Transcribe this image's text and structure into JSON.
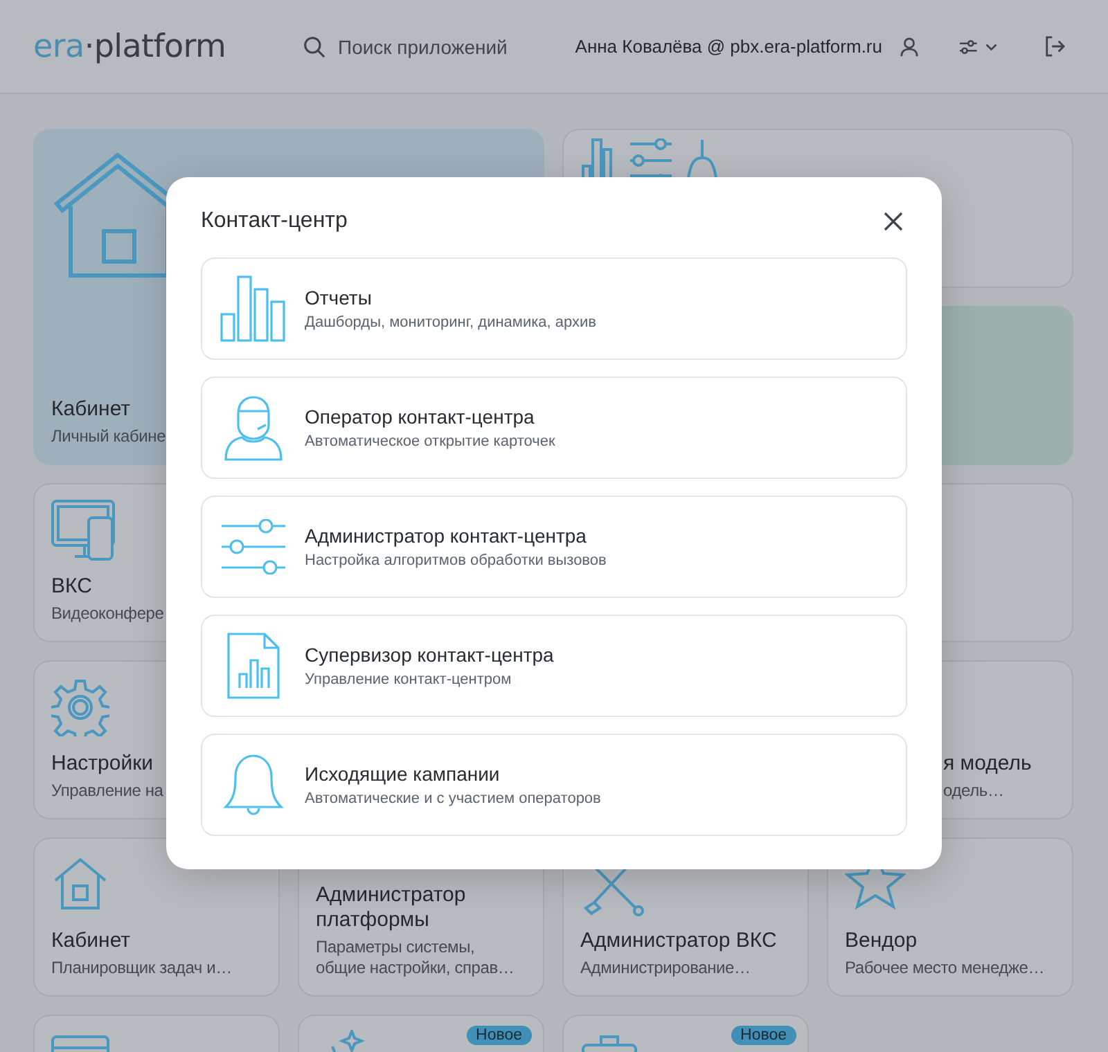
{
  "header": {
    "logo": {
      "accent": "era",
      "rest": "·platform"
    },
    "search": {
      "placeholder": "Поиск приложений"
    },
    "user": "Анна Ковалёва @ pbx.era-platform.ru"
  },
  "tiles": [
    {
      "kind": "featured",
      "title": "Кабинет",
      "subtitle": "Личный кабине"
    },
    {
      "kind": "contact"
    },
    {
      "kind": "accent"
    },
    {
      "kind": "devices",
      "title": "ВКС",
      "subtitle": "Видеоконфере"
    },
    {
      "kind": "blank"
    },
    {
      "kind": "gear",
      "title": "Настройки",
      "subtitle": "Управление на"
    },
    {
      "kind": "partial",
      "title": "я модель",
      "subtitle": "одель…"
    },
    {
      "kind": "home",
      "title": "Кабинет",
      "subtitle": "Планировщик задач и…"
    },
    {
      "kind": "text",
      "title": "Администратор платформы",
      "subtitle": "Параметры системы, общие настройки, справ…"
    },
    {
      "kind": "tools",
      "title": "Администратор ВКС",
      "subtitle": "Администрирование…"
    },
    {
      "kind": "star",
      "title": "Вендор",
      "subtitle": "Рабочее место менедже…"
    },
    {
      "kind": "card"
    },
    {
      "kind": "sparkles",
      "badge": "Новое"
    },
    {
      "kind": "briefcase",
      "badge": "Новое"
    }
  ],
  "modal": {
    "title": "Контакт-центр",
    "items": [
      {
        "kind": "bars",
        "title": "Отчеты",
        "subtitle": "Дашборды, мониторинг, динамика, архив"
      },
      {
        "kind": "operator",
        "title": "Оператор контакт-центра",
        "subtitle": "Автоматическое открытие карточек"
      },
      {
        "kind": "sliders",
        "title": "Администратор контакт-центра",
        "subtitle": "Настройка алгоритмов обработки вызовов"
      },
      {
        "kind": "document",
        "title": "Супервизор контакт-центра",
        "subtitle": "Управление контакт-центром"
      },
      {
        "kind": "bell",
        "title": "Исходящие кампании",
        "subtitle": "Автоматические и с участием операторов"
      }
    ]
  }
}
